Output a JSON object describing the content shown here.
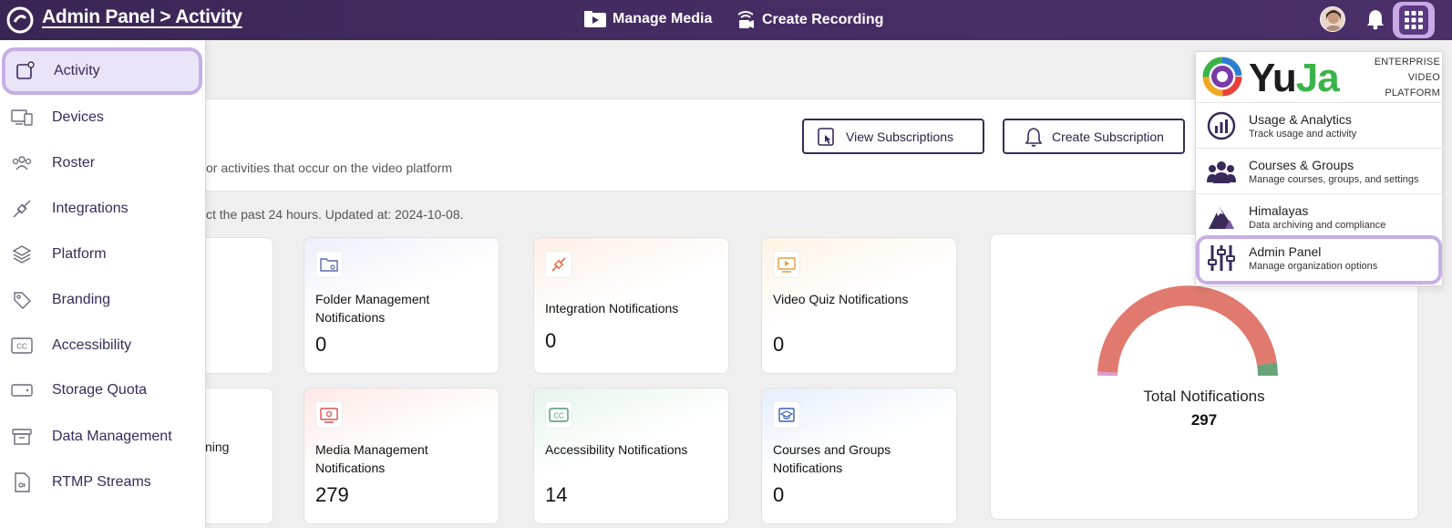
{
  "header": {
    "breadcrumb": "Admin Panel > Activity",
    "manage_media": "Manage Media",
    "create_recording": "Create Recording"
  },
  "sidebar": {
    "items": [
      {
        "label": "Activity",
        "icon": "activity-icon"
      },
      {
        "label": "Devices",
        "icon": "devices-icon"
      },
      {
        "label": "Roster",
        "icon": "roster-icon"
      },
      {
        "label": "Integrations",
        "icon": "integrations-icon"
      },
      {
        "label": "Platform",
        "icon": "platform-layers-icon"
      },
      {
        "label": "Branding",
        "icon": "branding-icon"
      },
      {
        "label": "Accessibility",
        "icon": "cc-icon"
      },
      {
        "label": "Storage Quota",
        "icon": "storage-icon"
      },
      {
        "label": "Data Management",
        "icon": "archive-icon"
      },
      {
        "label": "RTMP Streams",
        "icon": "rtmp-icon"
      }
    ]
  },
  "main": {
    "description": "or activities that occur on the video platform",
    "note": "ct the past 24 hours. Updated at: 2024-10-08.",
    "view_subscriptions": "View Subscriptions",
    "create_subscription": "Create Subscription"
  },
  "cards": [
    {
      "title": "Folder Management Notifications",
      "value": "0"
    },
    {
      "title": "Integration Notifications",
      "value": "0"
    },
    {
      "title": "Video Quiz Notifications",
      "value": "0"
    },
    {
      "title": "Media Management Notifications",
      "value": "279"
    },
    {
      "title": "Accessibility Notifications",
      "value": "14"
    },
    {
      "title": "Courses and Groups Notifications",
      "value": "0"
    }
  ],
  "partial_card_text": "ning",
  "donut": {
    "label": "Total Notifications",
    "total": "297",
    "colors": {
      "main": "#e07a6e",
      "accent": "#6aa37a",
      "small": "#e19bd0"
    }
  },
  "dropdown": {
    "brand": {
      "yu": "Yu",
      "ja": "Ja"
    },
    "enterprise_lines": [
      "ENTERPRISE",
      "VIDEO",
      "PLATFORM"
    ],
    "items": [
      {
        "title": "Usage & Analytics",
        "subtitle": "Track usage and activity"
      },
      {
        "title": "Courses & Groups",
        "subtitle": "Manage courses, groups, and settings"
      },
      {
        "title": "Himalayas",
        "subtitle": "Data archiving and compliance"
      },
      {
        "title": "Admin Panel",
        "subtitle": "Manage organization options"
      }
    ]
  },
  "colors": {
    "topbar": "#3f2a5c",
    "highlight": "#c7aee5",
    "brand_purple": "#3a2a5a"
  }
}
